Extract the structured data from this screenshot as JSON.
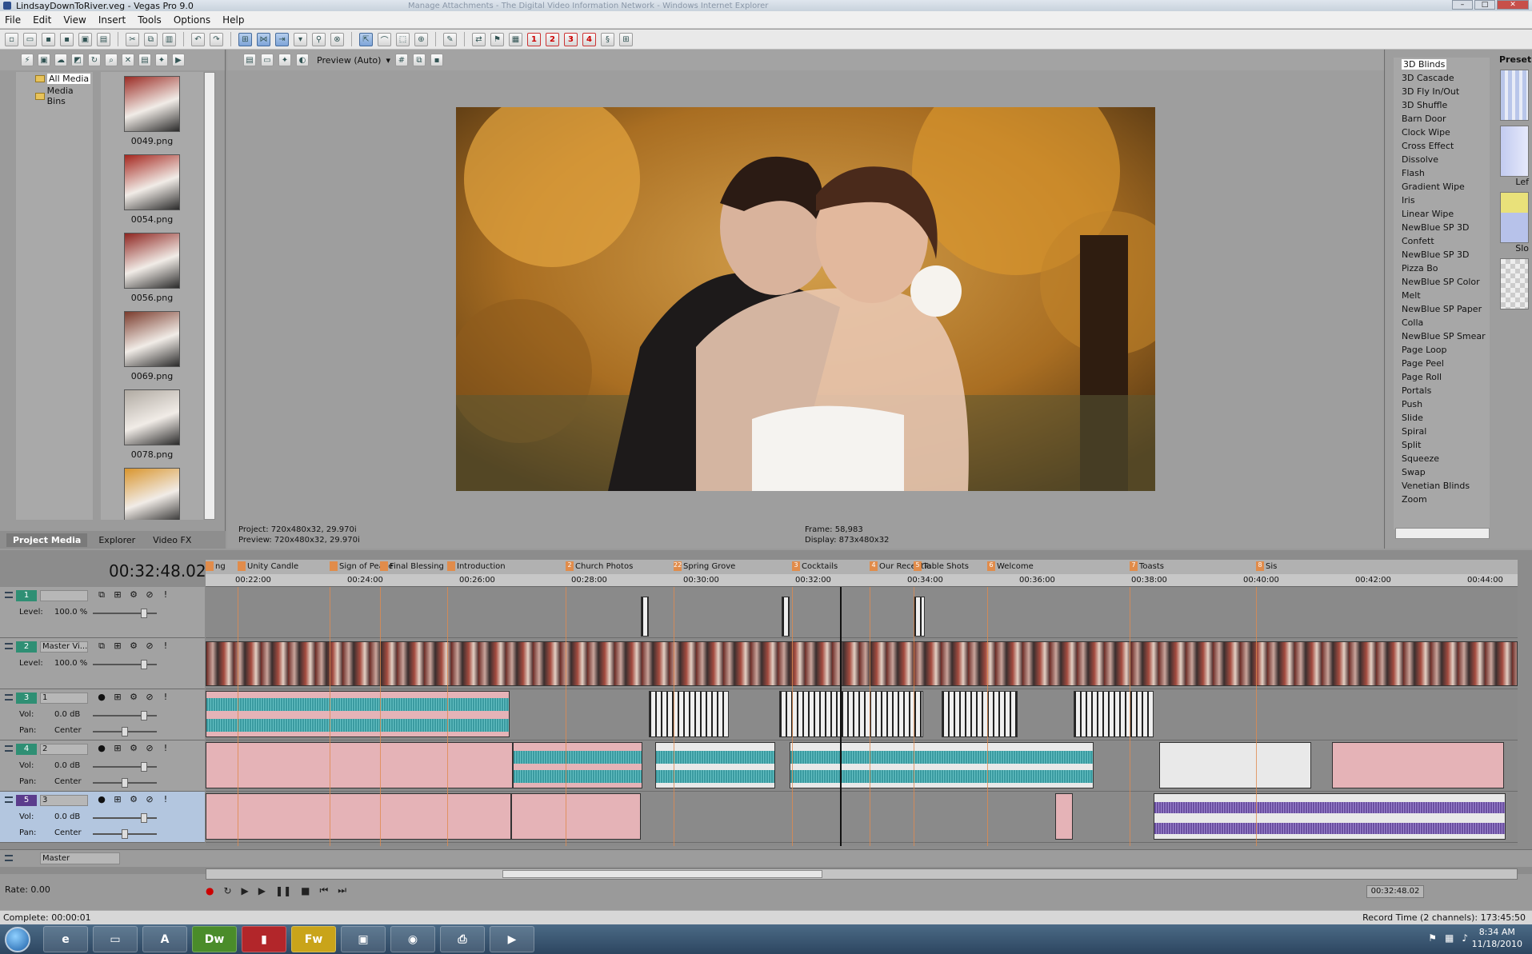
{
  "window": {
    "title": "LindsayDownToRiver.veg - Vegas Pro 9.0",
    "background_window": "Manage Attachments - The Digital Video Information Network - Windows Internet Explorer"
  },
  "menu": [
    "File",
    "Edit",
    "View",
    "Insert",
    "Tools",
    "Options",
    "Help"
  ],
  "toolbar": {
    "group_numbers": [
      "1",
      "2",
      "3",
      "4"
    ]
  },
  "media": {
    "tree": [
      {
        "label": "All Media",
        "selected": true
      },
      {
        "label": "Media Bins",
        "selected": false
      }
    ],
    "thumbnails": [
      {
        "name": "0049.png",
        "tone": "#9b2b24"
      },
      {
        "name": "0054.png",
        "tone": "#a5261e"
      },
      {
        "name": "0056.png",
        "tone": "#8e2520"
      },
      {
        "name": "0069.png",
        "tone": "#7a3b2c"
      },
      {
        "name": "0078.png",
        "tone": "#b0aaa2"
      },
      {
        "name": "",
        "tone": "#d9952d"
      }
    ],
    "tabs": [
      "Project Media",
      "Explorer",
      "Video FX"
    ]
  },
  "preview": {
    "mode": "Preview (Auto)",
    "project": "Project:  720x480x32, 29.970i",
    "preview": "Preview:  720x480x32, 29.970i",
    "frame": "Frame:    58,983",
    "display": "Display:  873x480x32"
  },
  "transitions": {
    "items": [
      "3D Blinds",
      "3D Cascade",
      "3D Fly In/Out",
      "3D Shuffle",
      "Barn Door",
      "Clock Wipe",
      "Cross Effect",
      "Dissolve",
      "Flash",
      "Gradient Wipe",
      "Iris",
      "Linear Wipe",
      "NewBlue SP 3D Confett",
      "NewBlue SP 3D Pizza Bo",
      "NewBlue SP Color Melt",
      "NewBlue SP Paper Colla",
      "NewBlue SP Smear",
      "Page Loop",
      "Page Peel",
      "Page Roll",
      "Portals",
      "Push",
      "Slide",
      "Spiral",
      "Split",
      "Squeeze",
      "Swap",
      "Venetian Blinds",
      "Zoom"
    ],
    "selected": "3D Blinds",
    "presets_label": "Preset:",
    "preset_names": [
      "Lef",
      "Slo"
    ]
  },
  "timeline": {
    "time": "00:32:48.02",
    "markers": [
      {
        "num": "",
        "label": "ng"
      },
      {
        "num": "",
        "label": "Unity Candle"
      },
      {
        "num": "",
        "label": "Sign of Peace"
      },
      {
        "num": "",
        "label": "Final Blessing"
      },
      {
        "num": "",
        "label": "Introduction"
      },
      {
        "num": "2",
        "label": "Church Photos"
      },
      {
        "num": "22",
        "label": "Spring Grove"
      },
      {
        "num": "3",
        "label": "Cocktails"
      },
      {
        "num": "4",
        "label": "Our Receptio"
      },
      {
        "num": "5",
        "label": "Table Shots"
      },
      {
        "num": "6",
        "label": "Welcome"
      },
      {
        "num": "7",
        "label": "Toasts"
      },
      {
        "num": "8",
        "label": "Sis"
      }
    ],
    "ruler": [
      "00:22:00",
      "00:24:00",
      "00:26:00",
      "00:28:00",
      "00:30:00",
      "00:32:00",
      "00:34:00",
      "00:36:00",
      "00:38:00",
      "00:40:00",
      "00:42:00",
      "00:44:00"
    ],
    "tracks": [
      {
        "num": "1",
        "type": "video",
        "name": "",
        "l1": "Level:",
        "v1": "100.0 %",
        "color": "#2f8f74"
      },
      {
        "num": "2",
        "type": "video",
        "name": "Master Vi...",
        "l1": "Level:",
        "v1": "100.0 %",
        "color": "#2f8f74"
      },
      {
        "num": "3",
        "type": "audio",
        "name": "1",
        "l1": "Vol:",
        "v1": "0.0 dB",
        "l2": "Pan:",
        "v2": "Center",
        "color": "#2f8f74"
      },
      {
        "num": "4",
        "type": "audio",
        "name": "2",
        "l1": "Vol:",
        "v1": "0.0 dB",
        "l2": "Pan:",
        "v2": "Center",
        "color": "#2f8f74"
      },
      {
        "num": "5",
        "type": "audio",
        "name": "3",
        "l1": "Vol:",
        "v1": "0.0 dB",
        "l2": "Pan:",
        "v2": "Center",
        "color": "#5b3c8c"
      }
    ],
    "master_label": "Master",
    "rate": "Rate: 0.00",
    "readout": "00:32:48.02"
  },
  "status": {
    "left": "Complete: 00:00:01",
    "right": "Record Time (2 channels): 173:45:50"
  },
  "taskbar": {
    "apps": [
      "Dw",
      "Fw"
    ],
    "clock_time": "8:34 AM",
    "clock_date": "11/18/2010"
  }
}
